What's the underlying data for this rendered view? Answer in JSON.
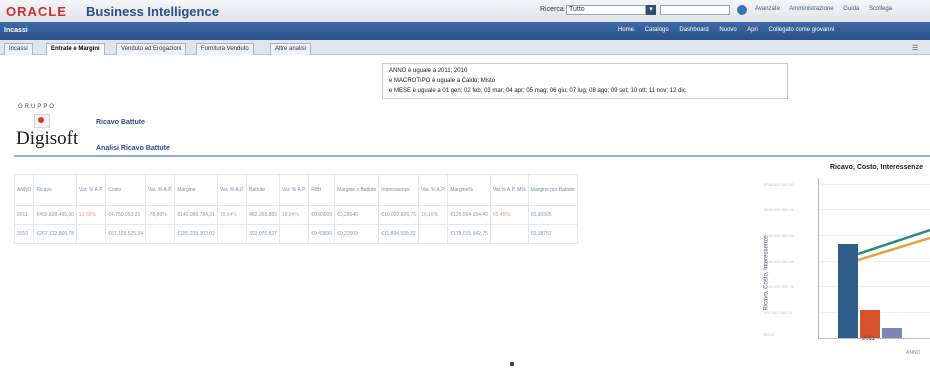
{
  "header": {
    "brand": "ORACLE",
    "product": "Business Intelligence",
    "search_label": "Ricerca",
    "search_scope": "Tutto",
    "top_links": [
      "Avanzate",
      "Amministrazione",
      "Guida",
      "Scollega"
    ]
  },
  "bluebar": {
    "page_name": "Incassi",
    "nav_links": [
      "Home",
      "Catalogo",
      "Dashboard",
      "Nuovo",
      "Apri",
      "Collegato come  giovanni"
    ]
  },
  "tabs": [
    "Incassi",
    "Entrate e Margini",
    "Venduto ed Erogazioni",
    "Fornitura Venduto",
    "Altre analisi"
  ],
  "filters": {
    "line1": "ANNO è uguale a 2011; 2010",
    "line2": "e MACROTIPO è uguale a Caldo; Misto",
    "line3": "e MESE è uguale a 01 gen; 02 feb; 03 mar; 04 apr; 05 mag; 06 giu; 07 lug; 08 ago; 09 set; 10 ott; 11 nov; 12 dic"
  },
  "logo": {
    "grupo": "GRUPPO",
    "name": "Digisoft"
  },
  "links": {
    "ricavo": "Ricavo Battute",
    "analisi": "Analisi Ricavo Battute"
  },
  "table": {
    "headers": [
      "ANNO",
      "Ricavo",
      "Var. % A.P.",
      "Costo",
      "Var. % A.P.",
      "Margine",
      "Var. % A.P.",
      "Battute",
      "Var. % A.P.",
      "R/Bt",
      "Margine x Battute",
      "Interessenze",
      "Var. % A.P.",
      "Margine%",
      "Var.% A.P. M%",
      "Margine per Battute"
    ],
    "rows": [
      [
        "2011",
        "€459.839.495,00",
        "13,56%",
        "€4.750.053,21",
        "-78,86%",
        "€140.099.784,31",
        "18,64%",
        "482.355.883",
        "18,84%",
        "€0,93000",
        "€0,28046",
        "€10.032.326,75",
        "16,16%",
        "€125.564.154,40",
        "65,45%",
        "€0,30305"
      ],
      [
        "2010",
        "€267.122.866,78",
        "",
        "€67.126.525,34",
        "",
        "€180.238.303,02",
        "",
        "392.070.827",
        "",
        "€0,43896",
        "€0,22009",
        "€11.894.935,22",
        "",
        "€178.015.942,75",
        "",
        "€0,38757"
      ]
    ]
  },
  "chart": {
    "title": "Ricavo, Costo, Interessenze",
    "ylabel": "Ricavo, Costo, Interessenze",
    "ticks": [
      "€300.000.000,00",
      "€250.000.000,00",
      "€200.000.000,00",
      "€150.000.000,00",
      "€100.000.000,00",
      "€50.000.000,00",
      "€0,00"
    ],
    "category": "2011",
    "xaxis_label": "ANNO",
    "colors": {
      "ricavo": "#2f5d8a",
      "costo": "#d4532c",
      "interessenze": "#7b86b5",
      "line1": "#2a8c7c",
      "line2": "#e0a43c"
    }
  }
}
